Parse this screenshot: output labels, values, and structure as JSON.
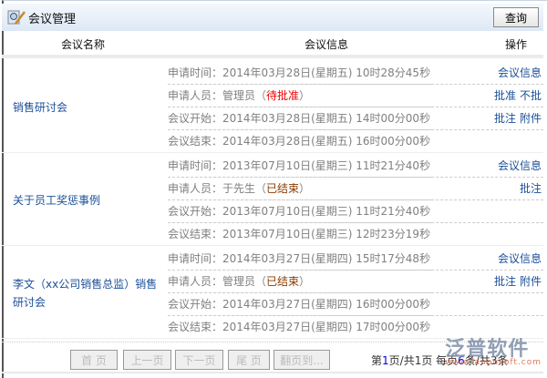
{
  "title": "会议管理",
  "query_button": "查询",
  "headers": {
    "name": "会议名称",
    "info": "会议信息",
    "ops": "操作"
  },
  "records": [
    {
      "name": "销售研讨会",
      "apply_time": "申请时间：2014年03月28日(星期五) 10时28分45秒",
      "applicant": "申请人员：管理员（",
      "status": "待批准",
      "status_close": "）",
      "start": "会议开始：2014年03月28日(星期五) 14时00分00秒",
      "end": "会议结束：2014年03月28日(星期五) 16时00分00秒",
      "ops": [
        [
          "会议信息"
        ],
        [
          "批准",
          "不批"
        ],
        [
          "批注",
          "附件"
        ]
      ]
    },
    {
      "name": "关于员工奖惩事例",
      "apply_time": "申请时间：2013年07月10日(星期三) 11时21分40秒",
      "applicant": "申请人员：于先生（",
      "status": "已结束",
      "status_close": "）",
      "start": "会议开始：2013年07月10日(星期三) 11时21分40秒",
      "end": "会议结束：2013年07月10日(星期三) 12时23分19秒",
      "ops": [
        [
          "会议信息"
        ],
        [
          "批注"
        ],
        []
      ]
    },
    {
      "name": "李文（xx公司销售总监）销售研讨会",
      "apply_time": "申请时间：2014年03月27日(星期四) 15时17分48秒",
      "applicant": "申请人员：管理员（",
      "status": "已结束",
      "status_close": "）",
      "start": "会议开始：2014年03月27日(星期四) 16时00分00秒",
      "end": "会议结束：2014年03月27日(星期四) 17时00分00秒",
      "ops": [
        [
          "会议信息"
        ],
        [
          "批注",
          "附件"
        ],
        []
      ]
    }
  ],
  "pager": {
    "first": "首 页",
    "prev": "上一页",
    "next": "下一页",
    "last": "尾 页",
    "goto": "翻页到...",
    "p1": "第",
    "cur": "1",
    "p2": "页/共",
    "total_pages": "1",
    "p3": "页 每页",
    "per": "6",
    "p4": "条/共",
    "total": "3",
    "p5": "条"
  },
  "logo": {
    "text": "泛普软件",
    "url": "www.fanpusoft.com"
  }
}
